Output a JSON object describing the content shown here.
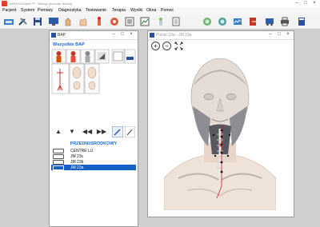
{
  "app": {
    "title": "AHEDS-Expert ™ - Wersja procedur licencji"
  },
  "menu": {
    "items": [
      "Pacjent",
      "System",
      "Pomiary",
      "Diagnostyka",
      "Testowanie",
      "Terapia",
      "Wyniki",
      "Okna",
      "Pomoc"
    ]
  },
  "bap_window": {
    "title": "BAP",
    "header_label": "Wszystkie BAP",
    "section_label": "PRZEDNI/SRODKOWY",
    "rows": [
      {
        "label": "CENTRE LU"
      },
      {
        "label": "JM 23c"
      },
      {
        "label": "JM 23b"
      },
      {
        "label": "JM 23a"
      }
    ],
    "selected_row": "JM 23a"
  },
  "image_window": {
    "title": "Points 23a - JM 23a"
  },
  "colors": {
    "accent": "#1560c8",
    "section_text": "#1a6ad1",
    "point_marker": "#cc1f2f"
  },
  "icons": {
    "zoom_in": "zoom-in-icon",
    "zoom_out": "zoom-out-icon",
    "fit": "fit-to-window-icon"
  }
}
